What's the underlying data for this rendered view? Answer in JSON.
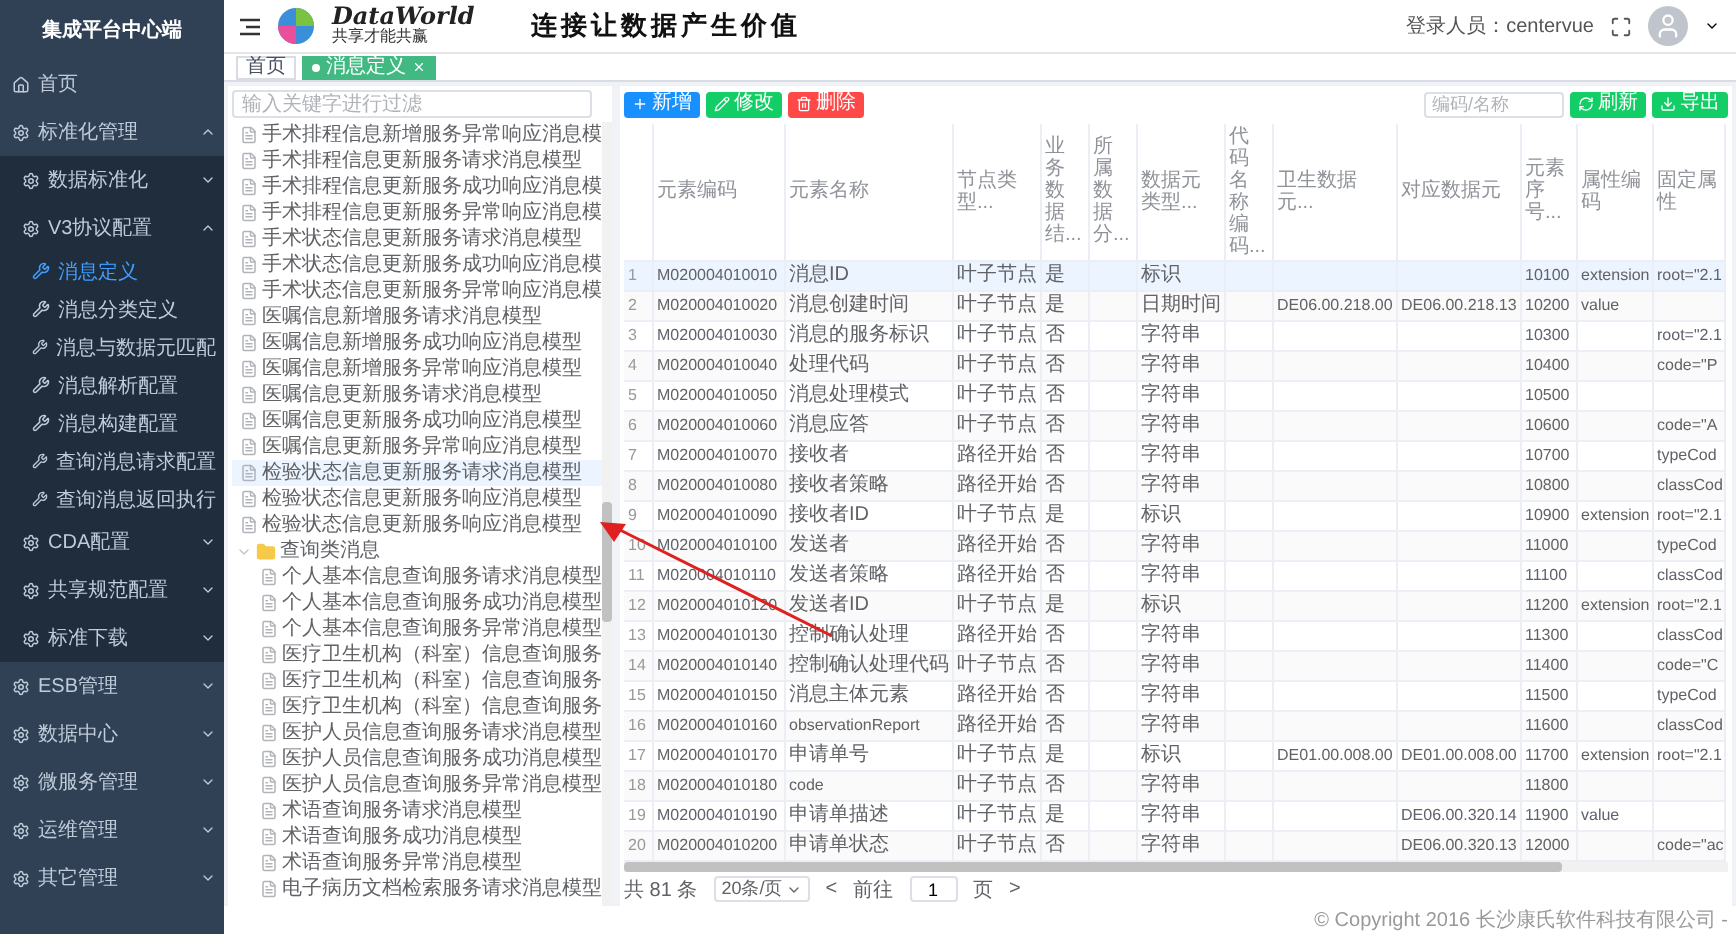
{
  "sidebar": {
    "title": "集成平台中心端",
    "items": [
      {
        "kind": "link",
        "label": "首页"
      },
      {
        "kind": "group",
        "label": "标准化管理",
        "expanded": true,
        "children": [
          {
            "kind": "group",
            "label": "数据标准化",
            "expanded": false
          },
          {
            "kind": "group",
            "label": "V3协议配置",
            "expanded": true,
            "children": [
              {
                "kind": "leaf",
                "label": "消息定义",
                "selected": true
              },
              {
                "kind": "leaf",
                "label": "消息分类定义",
                "selected": false
              },
              {
                "kind": "leaf",
                "label": "消息与数据元匹配",
                "selected": false
              },
              {
                "kind": "leaf",
                "label": "消息解析配置",
                "selected": false
              },
              {
                "kind": "leaf",
                "label": "消息构建配置",
                "selected": false
              },
              {
                "kind": "leaf",
                "label": "查询消息请求配置",
                "selected": false
              },
              {
                "kind": "leaf",
                "label": "查询消息返回执行",
                "selected": false
              }
            ]
          },
          {
            "kind": "group",
            "label": "CDA配置",
            "expanded": false
          },
          {
            "kind": "group",
            "label": "共享规范配置",
            "expanded": false
          },
          {
            "kind": "group",
            "label": "标准下载",
            "expanded": false
          }
        ]
      },
      {
        "kind": "group",
        "label": "ESB管理",
        "expanded": false
      },
      {
        "kind": "group",
        "label": "数据中心",
        "expanded": false
      },
      {
        "kind": "group",
        "label": "微服务管理",
        "expanded": false
      },
      {
        "kind": "group",
        "label": "运维管理",
        "expanded": false
      },
      {
        "kind": "group",
        "label": "其它管理",
        "expanded": false
      }
    ]
  },
  "header": {
    "logo_name": "DataWorld",
    "logo_tagline": "共享才能共赢",
    "slogan": "连接让数据产生价值",
    "user_label": "登录人员：centervue"
  },
  "tabs": [
    {
      "label": "首页",
      "selected": false,
      "closable": false
    },
    {
      "label": "消息定义",
      "selected": true,
      "closable": true
    }
  ],
  "tree": {
    "filter_placeholder": "输入关键字进行过滤",
    "nodes": [
      {
        "kind": "file",
        "label": "手术排程信息新增服务异常响应消息模",
        "highlighted": false
      },
      {
        "kind": "file",
        "label": "手术排程信息更新服务请求消息模型",
        "highlighted": false
      },
      {
        "kind": "file",
        "label": "手术排程信息更新服务成功响应消息模",
        "highlighted": false
      },
      {
        "kind": "file",
        "label": "手术排程信息更新服务异常响应消息模",
        "highlighted": false
      },
      {
        "kind": "file",
        "label": "手术状态信息更新服务请求消息模型",
        "highlighted": false
      },
      {
        "kind": "file",
        "label": "手术状态信息更新服务成功响应消息模",
        "highlighted": false
      },
      {
        "kind": "file",
        "label": "手术状态信息更新服务异常响应消息模",
        "highlighted": false
      },
      {
        "kind": "file",
        "label": "医嘱信息新增服务请求消息模型",
        "highlighted": false
      },
      {
        "kind": "file",
        "label": "医嘱信息新增服务成功响应消息模型",
        "highlighted": false
      },
      {
        "kind": "file",
        "label": "医嘱信息新增服务异常响应消息模型",
        "highlighted": false
      },
      {
        "kind": "file",
        "label": "医嘱信息更新服务请求消息模型",
        "highlighted": false
      },
      {
        "kind": "file",
        "label": "医嘱信息更新服务成功响应消息模型",
        "highlighted": false
      },
      {
        "kind": "file",
        "label": "医嘱信息更新服务异常响应消息模型",
        "highlighted": false
      },
      {
        "kind": "file",
        "label": "检验状态信息更新服务请求消息模型",
        "highlighted": true
      },
      {
        "kind": "file",
        "label": "检验状态信息更新服务响应消息模型",
        "highlighted": false
      },
      {
        "kind": "file",
        "label": "检验状态信息更新服务响应消息模型",
        "highlighted": false
      },
      {
        "kind": "folder",
        "label": "查询类消息",
        "expanded": true,
        "children": [
          {
            "kind": "file",
            "label": "个人基本信息查询服务请求消息模型",
            "highlighted": false
          },
          {
            "kind": "file",
            "label": "个人基本信息查询服务成功消息模型",
            "highlighted": false
          },
          {
            "kind": "file",
            "label": "个人基本信息查询服务异常消息模型",
            "highlighted": false
          },
          {
            "kind": "file",
            "label": "医疗卫生机构（科室）信息查询服务",
            "highlighted": false
          },
          {
            "kind": "file",
            "label": "医疗卫生机构（科室）信息查询服务",
            "highlighted": false
          },
          {
            "kind": "file",
            "label": "医疗卫生机构（科室）信息查询服务",
            "highlighted": false
          },
          {
            "kind": "file",
            "label": "医护人员信息查询服务请求消息模型",
            "highlighted": false
          },
          {
            "kind": "file",
            "label": "医护人员信息查询服务成功消息模型",
            "highlighted": false
          },
          {
            "kind": "file",
            "label": "医护人员信息查询服务异常消息模型",
            "highlighted": false
          },
          {
            "kind": "file",
            "label": "术语查询服务请求消息模型",
            "highlighted": false
          },
          {
            "kind": "file",
            "label": "术语查询服务成功消息模型",
            "highlighted": false
          },
          {
            "kind": "file",
            "label": "术语查询服务异常消息模型",
            "highlighted": false
          },
          {
            "kind": "file",
            "label": "电子病历文档检索服务请求消息模型",
            "highlighted": false
          }
        ]
      }
    ]
  },
  "toolbar": {
    "buttons": [
      {
        "kind": "add",
        "label": "新增"
      },
      {
        "kind": "edit",
        "label": "修改"
      },
      {
        "kind": "delete",
        "label": "删除"
      }
    ],
    "search_placeholder": "编码/名称",
    "right_buttons": [
      {
        "kind": "refresh",
        "label": "刷新"
      },
      {
        "kind": "export",
        "label": "导出"
      }
    ]
  },
  "table": {
    "columns": [
      "元素编码",
      "元素名称",
      "节点类型...",
      "业务数据结...",
      "所属数据分...",
      "数据元类型...",
      "代码名称编码...",
      "卫生数据元...",
      "对应数据元",
      "元素序号...",
      "属性编码",
      "固定属性"
    ],
    "rows": [
      {
        "index": "1",
        "selected": true,
        "cells": [
          "M020004010010",
          "消息ID",
          "叶子节点",
          "是",
          "",
          "标识",
          "",
          "",
          "",
          "10100",
          "extension",
          "root=\"2.1"
        ]
      },
      {
        "index": "2",
        "selected": false,
        "cells": [
          "M020004010020",
          "消息创建时间",
          "叶子节点",
          "是",
          "",
          "日期时间",
          "",
          "DE06.00.218.00",
          "DE06.00.218.13",
          "10200",
          "value",
          ""
        ]
      },
      {
        "index": "3",
        "selected": false,
        "cells": [
          "M020004010030",
          "消息的服务标识",
          "叶子节点",
          "否",
          "",
          "字符串",
          "",
          "",
          "",
          "10300",
          "",
          "root=\"2.1"
        ]
      },
      {
        "index": "4",
        "selected": false,
        "cells": [
          "M020004010040",
          "处理代码",
          "叶子节点",
          "否",
          "",
          "字符串",
          "",
          "",
          "",
          "10400",
          "",
          "code=\"P"
        ]
      },
      {
        "index": "5",
        "selected": false,
        "cells": [
          "M020004010050",
          "消息处理模式",
          "叶子节点",
          "否",
          "",
          "字符串",
          "",
          "",
          "",
          "10500",
          "",
          ""
        ]
      },
      {
        "index": "6",
        "selected": false,
        "cells": [
          "M020004010060",
          "消息应答",
          "叶子节点",
          "否",
          "",
          "字符串",
          "",
          "",
          "",
          "10600",
          "",
          "code=\"A"
        ]
      },
      {
        "index": "7",
        "selected": false,
        "cells": [
          "M020004010070",
          "接收者",
          "路径开始",
          "否",
          "",
          "字符串",
          "",
          "",
          "",
          "10700",
          "",
          "typeCod"
        ]
      },
      {
        "index": "8",
        "selected": false,
        "cells": [
          "M020004010080",
          "接收者策略",
          "路径开始",
          "否",
          "",
          "字符串",
          "",
          "",
          "",
          "10800",
          "",
          "classCod"
        ]
      },
      {
        "index": "9",
        "selected": false,
        "cells": [
          "M020004010090",
          "接收者ID",
          "叶子节点",
          "是",
          "",
          "标识",
          "",
          "",
          "",
          "10900",
          "extension",
          "root=\"2.1"
        ]
      },
      {
        "index": "10",
        "selected": false,
        "cells": [
          "M020004010100",
          "发送者",
          "路径开始",
          "否",
          "",
          "字符串",
          "",
          "",
          "",
          "11000",
          "",
          "typeCod"
        ]
      },
      {
        "index": "11",
        "selected": false,
        "cells": [
          "M020004010110",
          "发送者策略",
          "路径开始",
          "否",
          "",
          "字符串",
          "",
          "",
          "",
          "11100",
          "",
          "classCod"
        ]
      },
      {
        "index": "12",
        "selected": false,
        "cells": [
          "M020004010120",
          "发送者ID",
          "叶子节点",
          "是",
          "",
          "标识",
          "",
          "",
          "",
          "11200",
          "extension",
          "root=\"2.1"
        ]
      },
      {
        "index": "13",
        "selected": false,
        "cells": [
          "M020004010130",
          "控制确认处理",
          "路径开始",
          "否",
          "",
          "字符串",
          "",
          "",
          "",
          "11300",
          "",
          "classCod"
        ]
      },
      {
        "index": "14",
        "selected": false,
        "cells": [
          "M020004010140",
          "控制确认处理代码",
          "叶子节点",
          "否",
          "",
          "字符串",
          "",
          "",
          "",
          "11400",
          "",
          "code=\"C"
        ]
      },
      {
        "index": "15",
        "selected": false,
        "cells": [
          "M020004010150",
          "消息主体元素",
          "路径开始",
          "否",
          "",
          "字符串",
          "",
          "",
          "",
          "11500",
          "",
          "typeCod"
        ]
      },
      {
        "index": "16",
        "selected": false,
        "cells": [
          "M020004010160",
          "observationReport",
          "路径开始",
          "否",
          "",
          "字符串",
          "",
          "",
          "",
          "11600",
          "",
          "classCod"
        ]
      },
      {
        "index": "17",
        "selected": false,
        "cells": [
          "M020004010170",
          "申请单号",
          "叶子节点",
          "是",
          "",
          "标识",
          "",
          "DE01.00.008.00",
          "DE01.00.008.00",
          "11700",
          "extension",
          "root=\"2.1"
        ]
      },
      {
        "index": "18",
        "selected": false,
        "cells": [
          "M020004010180",
          "code",
          "叶子节点",
          "否",
          "",
          "字符串",
          "",
          "",
          "",
          "11800",
          "",
          ""
        ]
      },
      {
        "index": "19",
        "selected": false,
        "cells": [
          "M020004010190",
          "申请单描述",
          "叶子节点",
          "是",
          "",
          "字符串",
          "",
          "",
          "DE06.00.320.14",
          "11900",
          "value",
          ""
        ]
      },
      {
        "index": "20",
        "selected": false,
        "cells": [
          "M020004010200",
          "申请单状态",
          "叶子节点",
          "否",
          "",
          "字符串",
          "",
          "",
          "DE06.00.320.13",
          "12000",
          "",
          "code=\"ac"
        ]
      }
    ]
  },
  "pagination": {
    "total": "共 81 条",
    "page_size": "20条/页",
    "prev": "<",
    "goto_label": "前往",
    "page": "1",
    "page_suffix": "页",
    "next": ">"
  },
  "footer": "© Copyright 2016 长沙康氏软件科技有限公司 -"
}
